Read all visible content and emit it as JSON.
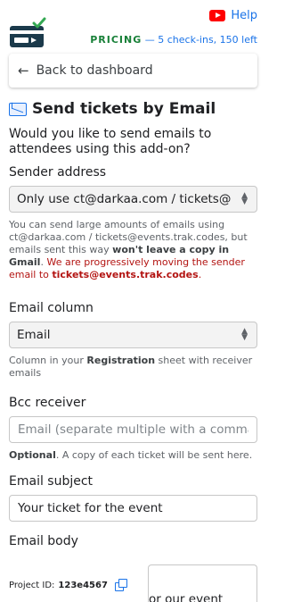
{
  "header": {
    "help_label": "Help",
    "pricing_label": "PRICING",
    "pricing_detail": " — 5 check-ins, 150 left"
  },
  "nav": {
    "back_label": "Back to dashboard"
  },
  "section": {
    "title": "Send tickets by Email",
    "question": "Would you like to send emails to attendees using this add-on?"
  },
  "sender": {
    "label": "Sender address",
    "value": "Only use ct@darkaa.com / tickets@events.trak.codes",
    "help_pre": "You can send large amounts of emails using ct@darkaa.com / tickets@events.trak.codes, but emails sent this way ",
    "help_bold": "won't leave a copy in Gmail",
    "help_post": ".",
    "warn_pre": "We are progressively moving the sender email to ",
    "warn_bold": "tickets@events.trak.codes",
    "warn_post": "."
  },
  "email_column": {
    "label": "Email column",
    "value": "Email",
    "help_pre": "Column in your ",
    "help_bold": "Registration",
    "help_post": " sheet with receiver emails"
  },
  "bcc": {
    "label": "Bcc receiver",
    "placeholder": "Email (separate multiple with a comma)",
    "help_bold": "Optional",
    "help_post": ". A copy of each ticket will be sent here."
  },
  "subject": {
    "label": "Email subject",
    "value": "Your ticket for the event"
  },
  "body": {
    "label": "Email body",
    "visible_text": "or our event"
  },
  "footer": {
    "project_label": "Project ID:",
    "project_id": "123e4567"
  },
  "colors": {
    "accent_blue": "#1a73e8",
    "pricing_green": "#188038",
    "warning_red": "#b31412",
    "help_red": "#ff0000"
  }
}
